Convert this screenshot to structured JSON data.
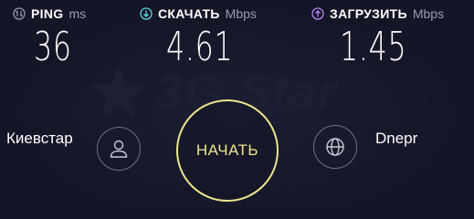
{
  "metrics": {
    "ping": {
      "title": "PING",
      "unit": "ms",
      "value": "36",
      "icon": "ping-icon",
      "color": "#9a9bb0"
    },
    "download": {
      "title": "СКАЧАТЬ",
      "unit": "Mbps",
      "value": "4.61",
      "icon": "download-arrow-icon",
      "color": "#5ad6e0"
    },
    "upload": {
      "title": "ЗАГРУЗИТЬ",
      "unit": "Mbps",
      "value": "1.45",
      "icon": "upload-arrow-icon",
      "color": "#b784f2"
    }
  },
  "isp": {
    "name": "Киевстар",
    "icon": "user-icon"
  },
  "server": {
    "name": "Dnepr",
    "icon": "globe-icon"
  },
  "go_button": {
    "label": "НАЧАТЬ",
    "color": "#ede58e"
  },
  "watermark": {
    "text": "3G Star"
  }
}
